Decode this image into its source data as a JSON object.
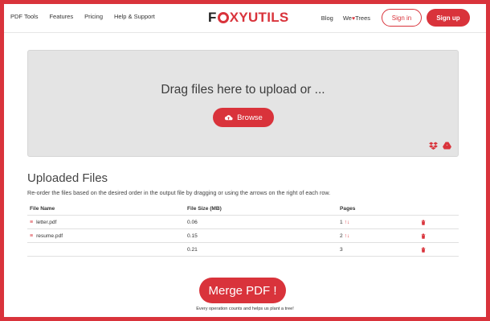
{
  "colors": {
    "accent": "#d9333b"
  },
  "nav": {
    "left": [
      "PDF Tools",
      "Features",
      "Pricing",
      "Help & Support"
    ],
    "logo_dark": "F",
    "logo_red": "XYUTILS",
    "blog": "Blog",
    "trees_pre": "We",
    "trees_heart": "♥",
    "trees_post": "Trees",
    "signin": "Sign in",
    "signup": "Sign up"
  },
  "dropzone": {
    "text": "Drag files here to upload or ...",
    "browse": "Browse",
    "icons": [
      "dropbox-icon",
      "google-drive-icon"
    ]
  },
  "uploaded": {
    "title": "Uploaded Files",
    "subtitle": "Re-order the files based on the desired order in the output file by dragging or using the arrows on the right of each row.",
    "headers": {
      "name": "File Name",
      "size": "File Size (MB)",
      "pages": "Pages"
    },
    "rows": [
      {
        "name": "letter.pdf",
        "size": "0.06",
        "pages": "1"
      },
      {
        "name": "resume.pdf",
        "size": "0.15",
        "pages": "2"
      }
    ],
    "total": {
      "size": "0.21",
      "pages": "3"
    }
  },
  "merge": {
    "label": "Merge PDF !",
    "footnote": "Every operation counts and helps us plant a tree!"
  }
}
